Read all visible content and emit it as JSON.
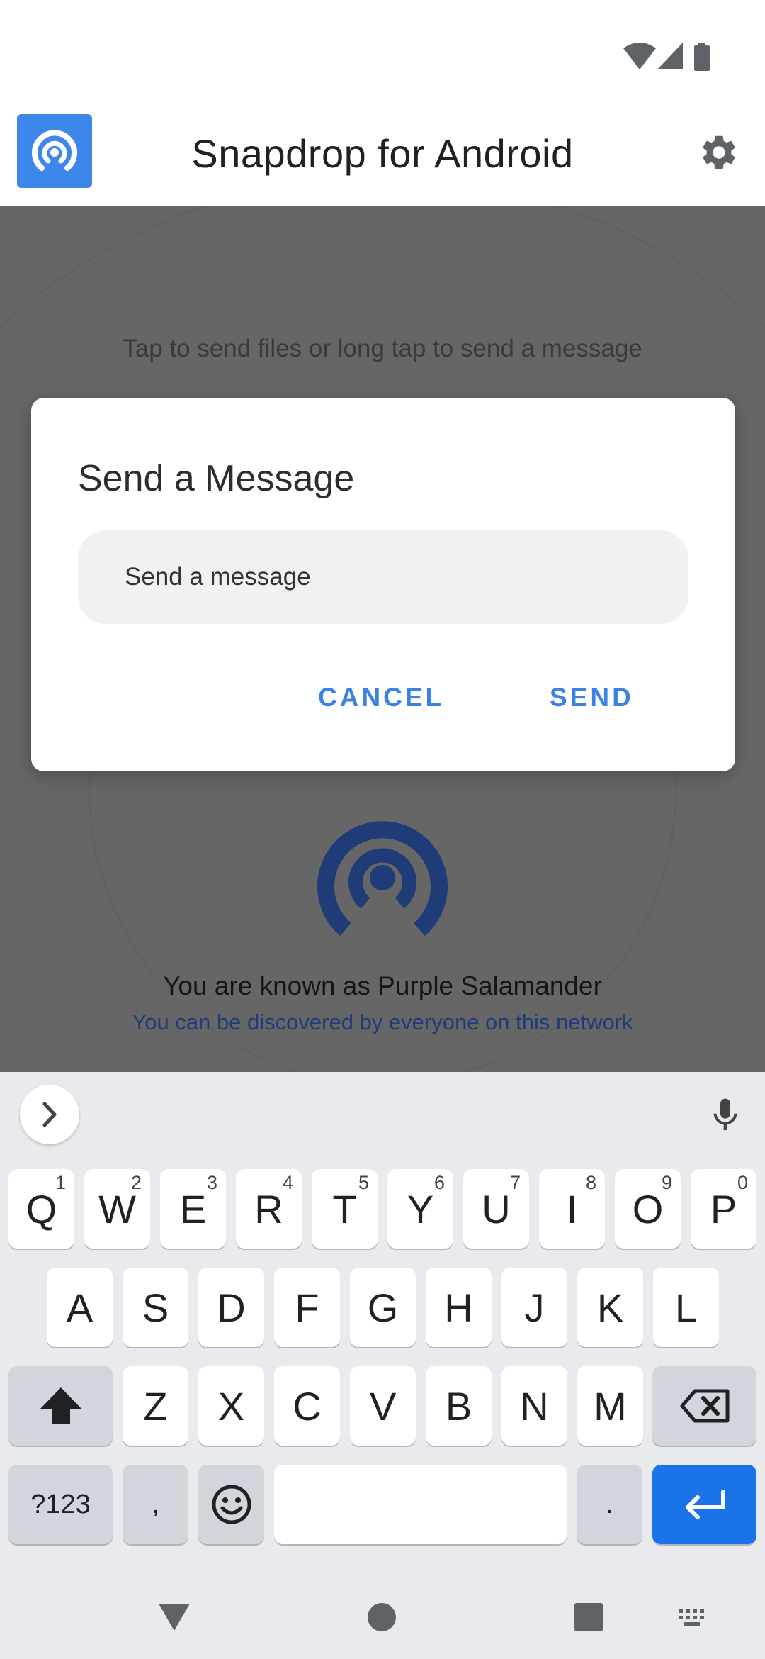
{
  "status_bar": {
    "icons": [
      "wifi-icon",
      "cellular-signal-icon",
      "battery-icon"
    ]
  },
  "app_bar": {
    "title": "Snapdrop for Android",
    "logo_icon": "snapdrop-broadcast-icon",
    "settings_icon": "gear-icon"
  },
  "main": {
    "hint": "Tap to send files or long tap to send a message",
    "known_as": "You are known as Purple Salamander",
    "discover": "You can be discovered by everyone on this network",
    "device_icon": "broadcast-icon"
  },
  "dialog": {
    "title": "Send a Message",
    "input_placeholder": "Send a message",
    "input_value": "",
    "cancel_label": "CANCEL",
    "send_label": "SEND"
  },
  "keyboard": {
    "row1": [
      {
        "key": "Q",
        "hint": "1"
      },
      {
        "key": "W",
        "hint": "2"
      },
      {
        "key": "E",
        "hint": "3"
      },
      {
        "key": "R",
        "hint": "4"
      },
      {
        "key": "T",
        "hint": "5"
      },
      {
        "key": "Y",
        "hint": "6"
      },
      {
        "key": "U",
        "hint": "7"
      },
      {
        "key": "I",
        "hint": "8"
      },
      {
        "key": "O",
        "hint": "9"
      },
      {
        "key": "P",
        "hint": "0"
      }
    ],
    "row2": [
      "A",
      "S",
      "D",
      "F",
      "G",
      "H",
      "J",
      "K",
      "L"
    ],
    "row3": [
      "Z",
      "X",
      "C",
      "V",
      "B",
      "N",
      "M"
    ],
    "symbols_label": "?123",
    "comma_label": ",",
    "period_label": ".",
    "space_label": ""
  },
  "colors": {
    "accent": "#3b82e4",
    "logo_bg": "#3d86ea",
    "device_icon": "#1f3c78",
    "enter_key": "#1a73e8",
    "scrim": "#666666"
  }
}
